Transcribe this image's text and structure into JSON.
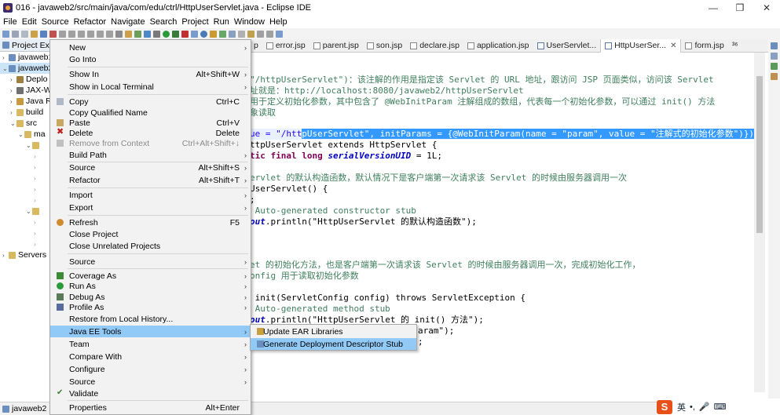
{
  "window": {
    "title": "016 - javaweb2/src/main/java/com/edu/ctrl/HttpUserServlet.java - Eclipse IDE",
    "minimize": "—",
    "maximize": "❐",
    "close": "✕"
  },
  "menubar": [
    "File",
    "Edit",
    "Source",
    "Refactor",
    "Navigate",
    "Search",
    "Project",
    "Run",
    "Window",
    "Help"
  ],
  "explorer": {
    "tab_label": "Project Expl",
    "rows": [
      {
        "arrow": "›",
        "label": "javaweb1"
      },
      {
        "arrow": "⌄",
        "label": "javaweb2"
      },
      {
        "arrow": "›",
        "label": "Deplo"
      },
      {
        "arrow": "›",
        "label": "JAX-W"
      },
      {
        "arrow": "›",
        "label": "Java R"
      },
      {
        "arrow": "›",
        "label": "build"
      },
      {
        "arrow": "⌄",
        "label": "src"
      },
      {
        "arrow": "⌄",
        "label": "ma"
      },
      {
        "arrow": "⌄",
        "label": ""
      },
      {
        "arrow": "⌄",
        "label": ""
      },
      {
        "arrow": "›",
        "label": "Servers"
      }
    ]
  },
  "editor_tabs": [
    {
      "label": "p"
    },
    {
      "label": "error.jsp"
    },
    {
      "label": "parent.jsp"
    },
    {
      "label": "son.jsp"
    },
    {
      "label": "declare.jsp"
    },
    {
      "label": "application.jsp"
    },
    {
      "label": "UserServlet..."
    },
    {
      "label": "HttpUserSer...",
      "active": true
    },
    {
      "label": "form.jsp"
    },
    {
      "label": "³⁶"
    }
  ],
  "code": {
    "l1": "\"/httpUserServlet\")：该注解的作用是指定该 Servlet 的 URL 地址，跟访问 JSP 页面类似，访问该 Servlet",
    "l2": "址就是：http://localhost:8080/javaweb2/httpUserServlet",
    "l3": "用于定义初始化参数，其中包含了 @WebInitParam 注解组成的数组，代表每一个初始化参数，可以通过 init() 方法",
    "l4": "象读取",
    "l5a": "ue = \"/htt",
    "l5b": "pUserServlet\", initParams = {@WebInitParam(name = \"param\", value = \"注解式的初始化参数\")})",
    "l6": "ttpUserServlet extends HttpServlet {",
    "l7a": "tic final long ",
    "l7b": "serialVersionUID",
    "l7c": " = 1L;",
    "l8": "ervlet 的默认构造函数，默认情况下是客户端第一次请求该 Servlet 的时候由服务器调用一次",
    "l9": "UserServlet() {",
    "l10": ";",
    "l11": " Auto-generated constructor stub",
    "l12a": "out",
    "l12b": ".println(\"HttpUserServlet 的默认构造函数\");",
    "l13": "et 的初始化方法，也是客户端第一次请求该 Servlet 的时候由服务器调用一次，完成初始化工作，",
    "l14": "onfig 用于读取初始化参数",
    "l15": " init(ServletConfig config) throws ServletException {",
    "l16": " Auto-generated method stub",
    "l17a": "out",
    "l17b": ".println(\"HttpUserServlet 的 init() 方法\");",
    "l18": "aram\");",
    "l19": ";"
  },
  "context_menu": {
    "items": [
      {
        "label": "New",
        "submenu": true
      },
      {
        "label": "Go Into"
      },
      {
        "label": "Show In",
        "shortcut": "Alt+Shift+W",
        "submenu": true
      },
      {
        "label": "Show in Local Terminal",
        "submenu": true
      },
      {
        "label": "Copy",
        "shortcut": "Ctrl+C"
      },
      {
        "label": "Copy Qualified Name"
      },
      {
        "label": "Paste",
        "shortcut": "Ctrl+V"
      },
      {
        "label": "Delete",
        "shortcut": "Delete"
      },
      {
        "label": "Remove from Context",
        "shortcut": "Ctrl+Alt+Shift+↓",
        "disabled": true
      },
      {
        "label": "Build Path",
        "submenu": true
      },
      {
        "label": "Source",
        "shortcut": "Alt+Shift+S",
        "submenu": true
      },
      {
        "label": "Refactor",
        "shortcut": "Alt+Shift+T",
        "submenu": true
      },
      {
        "label": "Import",
        "submenu": true
      },
      {
        "label": "Export",
        "submenu": true
      },
      {
        "label": "Refresh",
        "shortcut": "F5"
      },
      {
        "label": "Close Project"
      },
      {
        "label": "Close Unrelated Projects"
      },
      {
        "label": "Source",
        "submenu": true
      },
      {
        "label": "Coverage As",
        "submenu": true
      },
      {
        "label": "Run As",
        "submenu": true
      },
      {
        "label": "Debug As",
        "submenu": true
      },
      {
        "label": "Profile As",
        "submenu": true
      },
      {
        "label": "Restore from Local History..."
      },
      {
        "label": "Java EE Tools",
        "submenu": true,
        "hover": true
      },
      {
        "label": "Team",
        "submenu": true
      },
      {
        "label": "Compare With",
        "submenu": true
      },
      {
        "label": "Configure",
        "submenu": true
      },
      {
        "label": "Source",
        "submenu": true
      },
      {
        "label": "Validate"
      },
      {
        "label": "Properties",
        "shortcut": "Alt+Enter"
      }
    ]
  },
  "submenu": {
    "items": [
      {
        "label": "Update EAR Libraries"
      },
      {
        "label": "Generate Deployment Descriptor Stub",
        "hover": true
      }
    ]
  },
  "statusbar": {
    "label": "javaweb2"
  },
  "tray": {
    "s_logo": "S",
    "ime": "英",
    "punct": "•,",
    "mic": "🎤",
    "kbd": "⌨"
  },
  "colors": {
    "hover": "#91c9f7",
    "keyword": "#7f0055",
    "string": "#2a00ff",
    "comment": "#3f7f5f"
  }
}
